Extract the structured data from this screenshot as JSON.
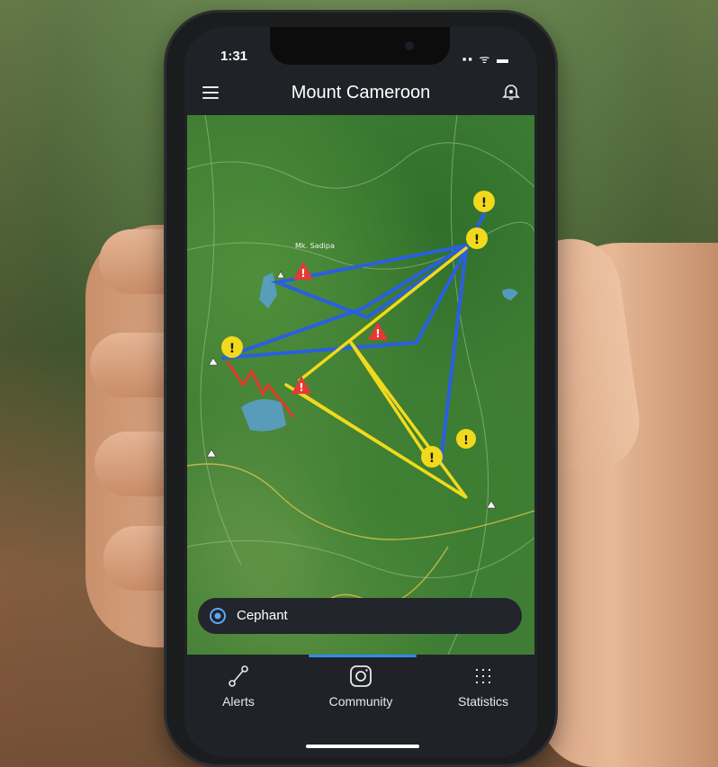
{
  "status": {
    "time": "1:31",
    "signal": "▪▪ ᯤ ▬"
  },
  "header": {
    "title": "Mount Cameroon"
  },
  "map": {
    "labels": [
      "Mk. Sadipa"
    ],
    "hazard_markers": 4,
    "warning_markers": 6
  },
  "search": {
    "value": "Cephant"
  },
  "tabs": [
    {
      "label": "Alerts",
      "icon": "route-icon"
    },
    {
      "label": "Community",
      "icon": "instagram-icon"
    },
    {
      "label": "Statistics",
      "icon": "grid-icon"
    }
  ],
  "colors": {
    "accent": "#2e8bf0",
    "route_blue": "#2a5fe0",
    "route_yellow": "#f2d91c",
    "route_red": "#e23a2a",
    "hazard": "#e53935"
  }
}
